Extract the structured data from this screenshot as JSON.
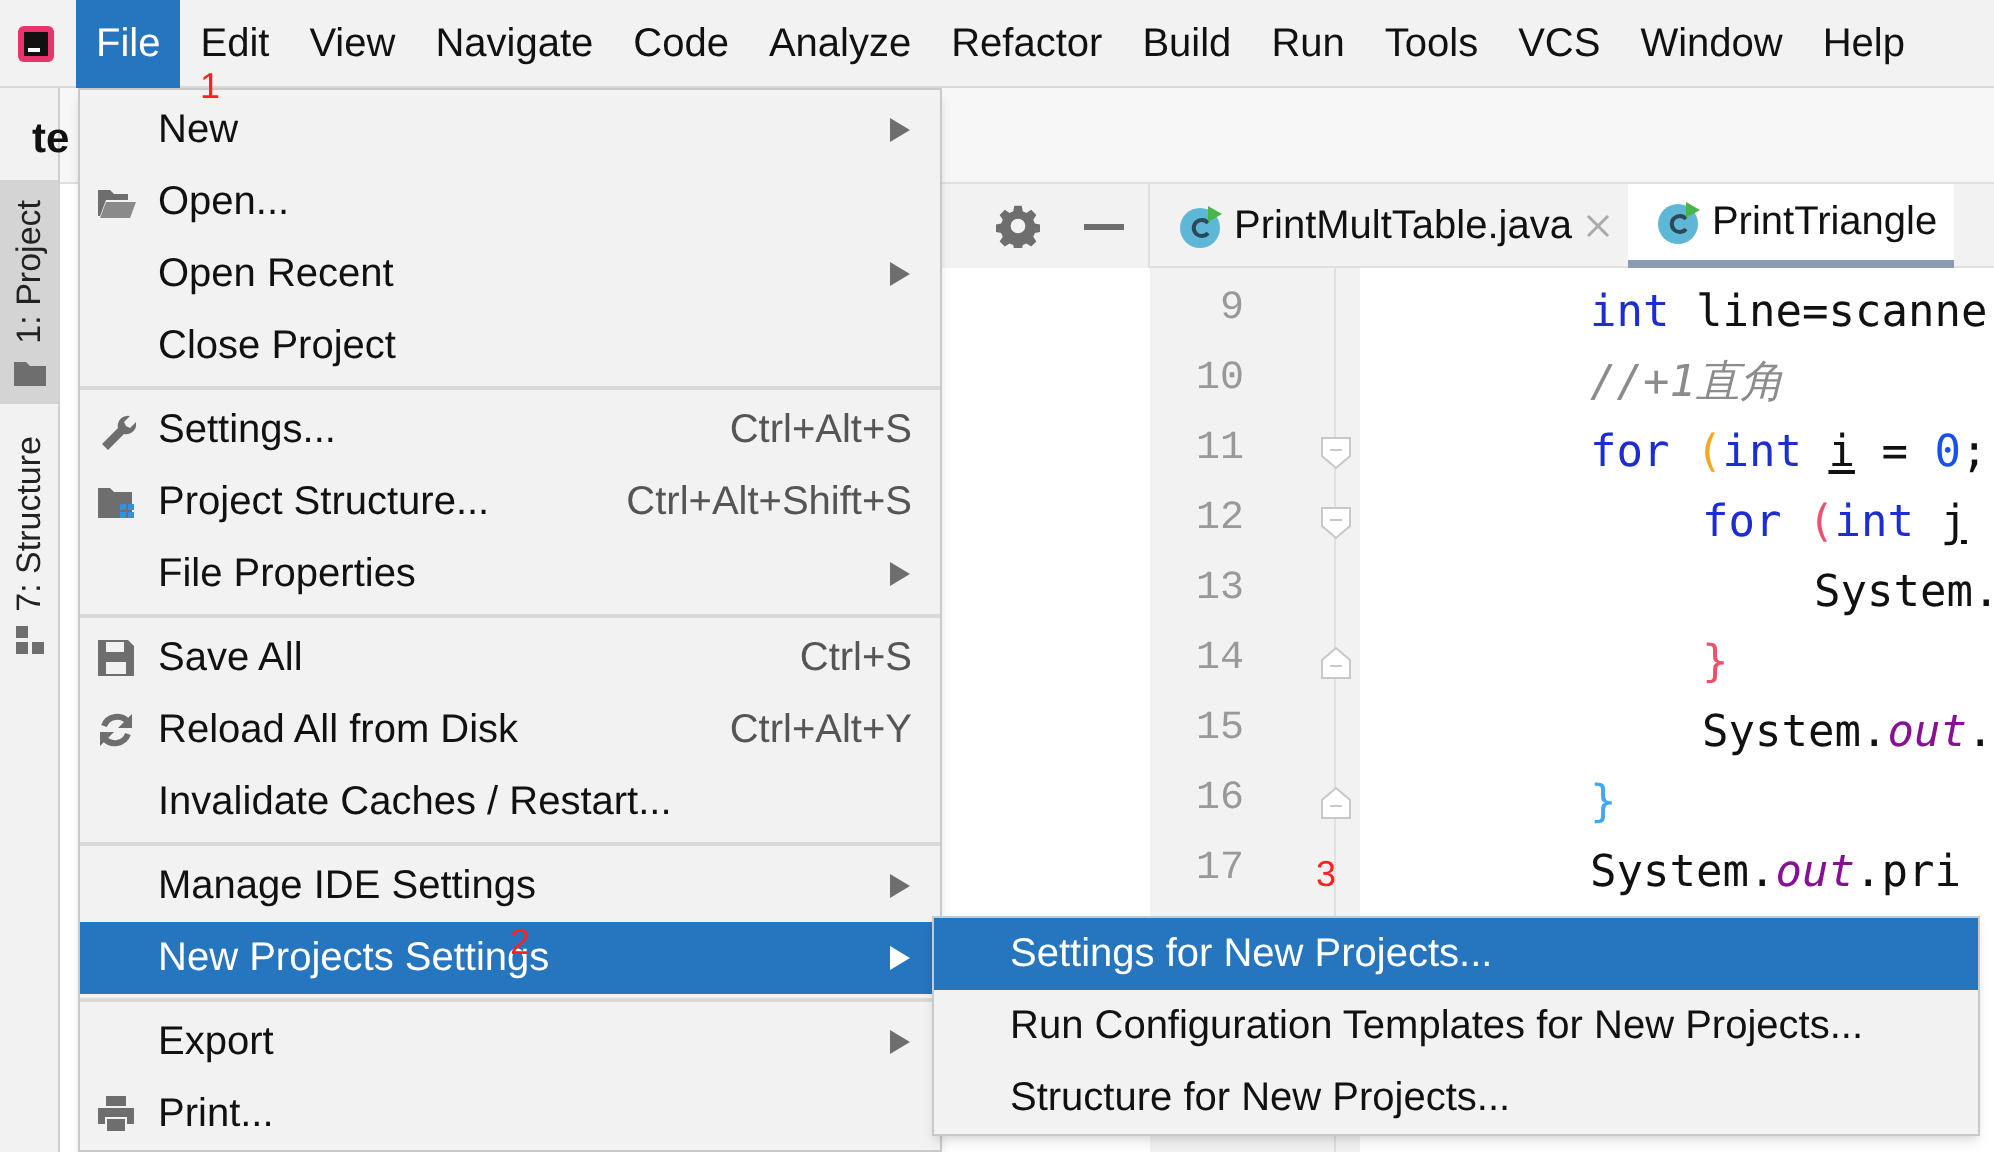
{
  "menu_bar": [
    {
      "label": "File",
      "selected": true
    },
    {
      "label": "Edit",
      "selected": false
    },
    {
      "label": "View",
      "selected": false
    },
    {
      "label": "Navigate",
      "selected": false
    },
    {
      "label": "Code",
      "selected": false
    },
    {
      "label": "Analyze",
      "selected": false
    },
    {
      "label": "Refactor",
      "selected": false
    },
    {
      "label": "Build",
      "selected": false
    },
    {
      "label": "Run",
      "selected": false
    },
    {
      "label": "Tools",
      "selected": false
    },
    {
      "label": "VCS",
      "selected": false
    },
    {
      "label": "Window",
      "selected": false
    },
    {
      "label": "Help",
      "selected": false
    }
  ],
  "project_title": "te",
  "tool_strip": [
    {
      "label": "1: Project",
      "selected": true
    },
    {
      "label": "7: Structure",
      "selected": false
    }
  ],
  "editor_tabs": [
    {
      "label": "PrintMultTable.java",
      "selected": false,
      "closable": true
    },
    {
      "label": "PrintTriangle",
      "selected": true,
      "closable": false
    }
  ],
  "editor": {
    "lines": [
      {
        "number": "9",
        "kind": "line",
        "tokens": [
          {
            "text": "int",
            "kind": "keyword"
          },
          {
            "text": " line=scanne",
            "kind": "plain"
          }
        ]
      },
      {
        "number": "10",
        "kind": "line",
        "tokens": [
          {
            "text": "//+1直角",
            "kind": "comment"
          }
        ]
      },
      {
        "number": "11",
        "kind": "block_start",
        "tokens": [
          {
            "text": "for ",
            "kind": "keyword"
          },
          {
            "text": "(",
            "kind": "bracket",
            "color": "#f5a623"
          },
          {
            "text": "int ",
            "kind": "keyword"
          },
          {
            "text": "i",
            "kind": "var"
          },
          {
            "text": " = ",
            "kind": "plain"
          },
          {
            "text": "0",
            "kind": "number"
          },
          {
            "text": ";",
            "kind": "plain"
          }
        ],
        "children": [
          {
            "number": "12",
            "kind": "block_start",
            "tokens": [
              {
                "text": "for ",
                "kind": "keyword"
              },
              {
                "text": "(",
                "kind": "bracket",
                "color": "#f0506e"
              },
              {
                "text": "int ",
                "kind": "keyword"
              },
              {
                "text": "j",
                "kind": "var"
              }
            ],
            "children": [
              {
                "number": "13",
                "kind": "line",
                "tokens": [
                  {
                    "text": "System.",
                    "kind": "plain"
                  }
                ]
              }
            ]
          },
          {
            "number": "14",
            "kind": "block_end",
            "tokens": [
              {
                "text": "}",
                "kind": "bracket",
                "color": "#f0506e"
              }
            ]
          },
          {
            "number": "15",
            "kind": "line",
            "tokens": [
              {
                "text": "System.",
                "kind": "plain"
              },
              {
                "text": "out",
                "kind": "field"
              },
              {
                "text": ".",
                "kind": "plain"
              }
            ]
          }
        ]
      },
      {
        "number": "16",
        "kind": "block_end",
        "tokens": [
          {
            "text": "}",
            "kind": "bracket",
            "color": "#3ea8f5"
          }
        ]
      },
      {
        "number": "17",
        "kind": "line",
        "tokens": [
          {
            "text": "System.",
            "kind": "plain"
          },
          {
            "text": "out",
            "kind": "field"
          },
          {
            "text": ".pri",
            "kind": "plain"
          }
        ]
      }
    ]
  },
  "file_menu": {
    "groups": [
      [
        {
          "label": "New",
          "submenu": true,
          "selected": false
        },
        {
          "label": "Open...",
          "submenu": false,
          "selected": false
        },
        {
          "label": "Open Recent",
          "submenu": true,
          "selected": false
        },
        {
          "label": "Close Project",
          "submenu": false,
          "selected": false
        }
      ],
      [
        {
          "label": "Settings...",
          "shortcut": "Ctrl+Alt+S",
          "submenu": false,
          "selected": false
        },
        {
          "label": "Project Structure...",
          "shortcut": "Ctrl+Alt+Shift+S",
          "submenu": false,
          "selected": false
        },
        {
          "label": "File Properties",
          "submenu": true,
          "selected": false
        }
      ],
      [
        {
          "label": "Save All",
          "shortcut": "Ctrl+S",
          "submenu": false,
          "selected": false
        },
        {
          "label": "Reload All from Disk",
          "shortcut": "Ctrl+Alt+Y",
          "submenu": false,
          "selected": false
        },
        {
          "label": "Invalidate Caches / Restart...",
          "submenu": false,
          "selected": false
        }
      ],
      [
        {
          "label": "Manage IDE Settings",
          "submenu": true,
          "selected": false
        },
        {
          "label": "New Projects Settings",
          "submenu": true,
          "selected": true
        }
      ],
      [
        {
          "label": "Export",
          "submenu": true,
          "selected": false
        },
        {
          "label": "Print...",
          "submenu": false,
          "selected": false
        }
      ]
    ]
  },
  "submenu": [
    {
      "label": "Settings for New Projects...",
      "selected": true
    },
    {
      "label": "Run Configuration Templates for New Projects...",
      "selected": false
    },
    {
      "label": "Structure for New Projects...",
      "selected": false
    }
  ],
  "annotations": [
    "1",
    "2",
    "3"
  ]
}
